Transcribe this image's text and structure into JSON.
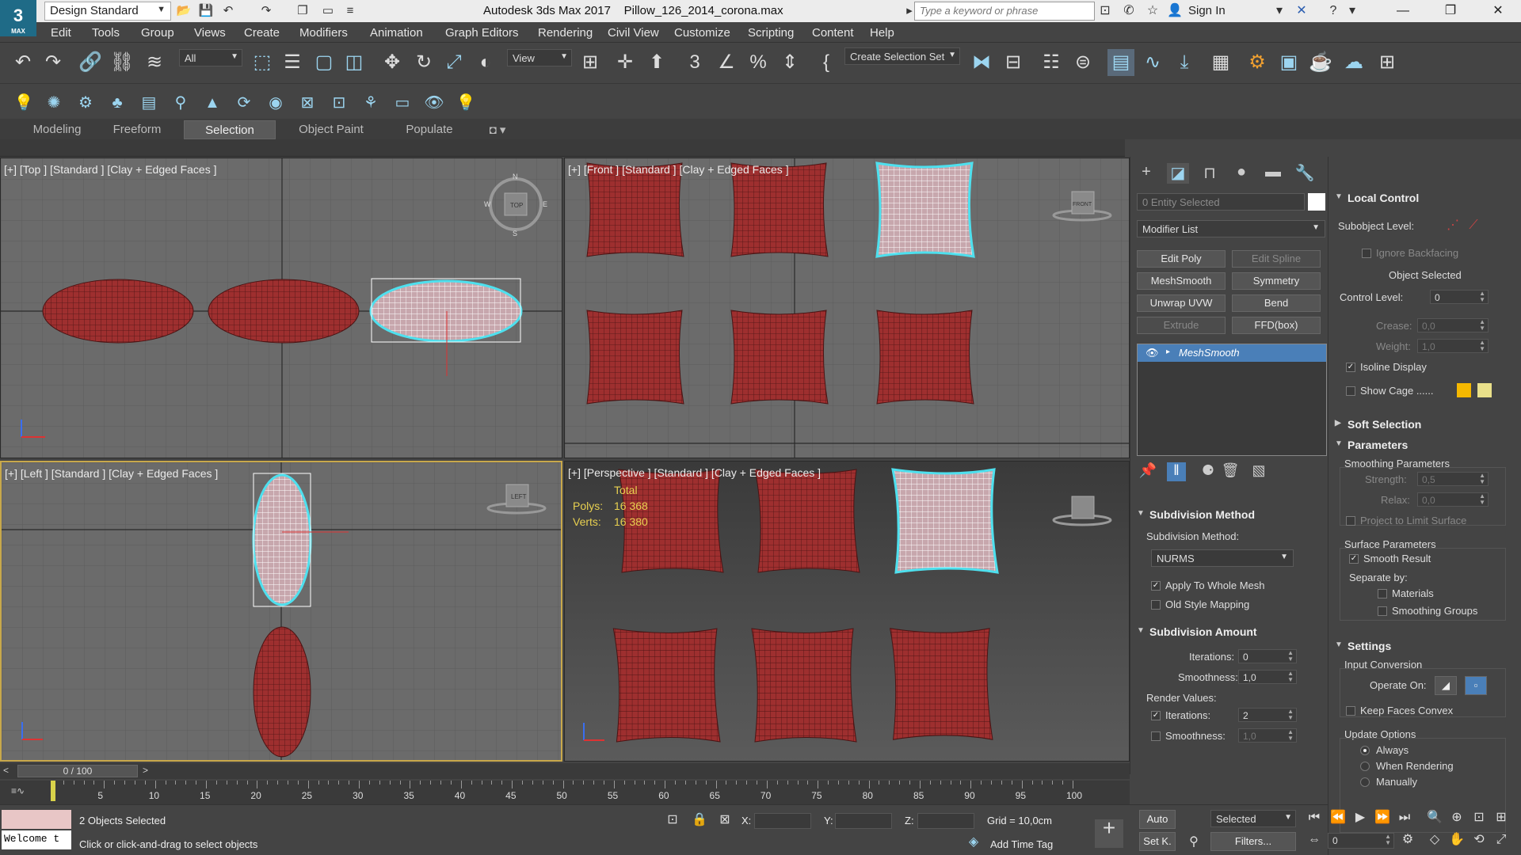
{
  "app": {
    "title": "Autodesk 3ds Max 2017",
    "file": "Pillow_126_2014_corona.max",
    "logo_text": "3",
    "logo_sub": "MAX",
    "workspace": "Design Standard",
    "search_placeholder": "Type a keyword or phrase",
    "sign_in": "Sign In"
  },
  "menu": [
    "Edit",
    "Tools",
    "Group",
    "Views",
    "Create",
    "Modifiers",
    "Animation",
    "Graph Editors",
    "Rendering",
    "Civil View",
    "Customize",
    "Scripting",
    "Content",
    "Help"
  ],
  "toolbar": {
    "filter": "All",
    "ref_coord": "View",
    "selection_set": "Create Selection Set"
  },
  "ribbon": {
    "tabs": [
      "Modeling",
      "Freeform",
      "Selection",
      "Object Paint",
      "Populate"
    ],
    "active": "Selection"
  },
  "viewports": {
    "top": "[+] [Top ] [Standard ] [Clay + Edged Faces ]",
    "front": "[+] [Front ] [Standard ] [Clay + Edged Faces ]",
    "left": "[+] [Left ] [Standard ] [Clay + Edged Faces ]",
    "perspective": "[+] [Perspective ] [Standard ] [Clay + Edged Faces ]",
    "viewcube_top": "TOP",
    "viewcube_front": "FRONT",
    "viewcube_left": "LEFT",
    "compass": {
      "n": "N",
      "s": "S",
      "e": "E",
      "w": "W"
    },
    "stats": {
      "total": "Total",
      "polys_label": "Polys:",
      "polys": "16 368",
      "verts_label": "Verts:",
      "verts": "16 380"
    }
  },
  "command_panel": {
    "selection_name": "0 Entity Selected",
    "modifier_list": "Modifier List",
    "buttons": [
      {
        "label": "Edit Poly",
        "enabled": true
      },
      {
        "label": "Edit Spline",
        "enabled": false
      },
      {
        "label": "MeshSmooth",
        "enabled": true
      },
      {
        "label": "Symmetry",
        "enabled": true
      },
      {
        "label": "Unwrap UVW",
        "enabled": true
      },
      {
        "label": "Bend",
        "enabled": true
      },
      {
        "label": "Extrude",
        "enabled": false
      },
      {
        "label": "FFD(box)",
        "enabled": true
      }
    ],
    "stack_item": "MeshSmooth",
    "subdivision_method": {
      "title": "Subdivision Method",
      "label": "Subdivision Method:",
      "value": "NURMS",
      "apply_whole": "Apply To Whole Mesh",
      "old_style": "Old Style Mapping"
    },
    "subdivision_amount": {
      "title": "Subdivision Amount",
      "iterations_label": "Iterations:",
      "iterations": "0",
      "smoothness_label": "Smoothness:",
      "smoothness": "1,0",
      "render_values": "Render Values:",
      "r_iterations_label": "Iterations:",
      "r_iterations": "2",
      "r_smoothness_label": "Smoothness:",
      "r_smoothness": "1,0"
    }
  },
  "rollouts": {
    "local_control": "Local Control",
    "subobject_level": "Subobject Level:",
    "ignore_backfacing": "Ignore Backfacing",
    "object_selected": "Object Selected",
    "control_level_label": "Control Level:",
    "control_level": "0",
    "crease_label": "Crease:",
    "crease": "0,0",
    "weight_label": "Weight:",
    "weight": "1,0",
    "isoline_display": "Isoline Display",
    "show_cage": "Show Cage ......",
    "cage_colors": [
      "#f5b800",
      "#e9e08a"
    ],
    "soft_selection": "Soft Selection",
    "parameters": "Parameters",
    "smoothing_parameters": "Smoothing Parameters",
    "strength_label": "Strength:",
    "strength": "0,5",
    "relax_label": "Relax:",
    "relax": "0,0",
    "project_limit": "Project to Limit Surface",
    "surface_parameters": "Surface Parameters",
    "smooth_result": "Smooth Result",
    "separate_by": "Separate by:",
    "materials": "Materials",
    "smoothing_groups": "Smoothing Groups",
    "settings": "Settings",
    "input_conversion": "Input Conversion",
    "operate_on": "Operate On:",
    "keep_faces_convex": "Keep Faces Convex",
    "update_options": "Update Options",
    "always": "Always",
    "when_rendering": "When Rendering",
    "manually": "Manually"
  },
  "timeline": {
    "frame": "0 / 100",
    "ticks": [
      "5",
      "10",
      "15",
      "20",
      "25",
      "30",
      "35",
      "40",
      "45",
      "50",
      "55",
      "60",
      "65",
      "70",
      "75",
      "80",
      "85",
      "90",
      "95",
      "100"
    ]
  },
  "status": {
    "maxscript": "Welcome t",
    "selected": "2 Objects Selected",
    "prompt": "Click or click-and-drag to select objects",
    "x_label": "X:",
    "y_label": "Y:",
    "z_label": "Z:",
    "grid": "Grid = 10,0cm",
    "add_time_tag": "Add Time Tag",
    "auto": "Auto",
    "setk": "Set K.",
    "selected_dd": "Selected",
    "filters": "Filters...",
    "frame_field": "0"
  },
  "colors": {
    "pillow": "#9e2f2f",
    "selection": "#4ee0ee",
    "active_border": "#c8a84b",
    "accent": "#4a7fb8"
  }
}
